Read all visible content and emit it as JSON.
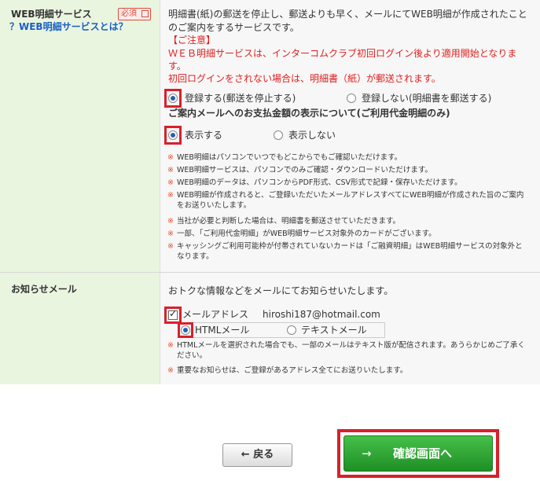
{
  "web_statement": {
    "label": "WEB明細サービス",
    "required_badge": "必須",
    "help_link": "？WEB明細サービスとは？",
    "intro_line1": "明細書(紙)の郵送を停止し、郵送よりも早く、メールにてWEB明細が作成されたこと",
    "intro_line2": "のご案内をするサービスです。",
    "caution_title": "【ご注意】",
    "caution_line1": "ＷＥＢ明細サービスは、インターコムクラブ初回ログイン後より適用開始となりま",
    "caution_line2": "す。",
    "caution_line3": "初回ログインをされない場合は、明細書（紙）が郵送されます。",
    "register_option": "登録する(郵送を停止する)",
    "no_register_option": "登録しない(明細書を郵送する)",
    "register_selected": true,
    "amount_heading": "ご案内メールへのお支払金額の表示について(ご利用代金明細のみ)",
    "show_option": "表示する",
    "hide_option": "表示しない",
    "show_selected": true,
    "notes": [
      "WEB明細はパソコンでいつでもどこからでもご確認いただけます。",
      "WEB明細サービスは、パソコンでのみご確認・ダウンロードいただけます。",
      "WEB明細のデータは、パソコンからPDF形式、CSV形式で記録・保存いただけます。",
      "WEB明細が作成されると、ご登録いただいたメールアドレスすべてにWEB明細が作成された旨のご案内をお送りいたします。",
      "当社が必要と判断した場合は、明細書を郵送させていただきます。",
      "一部、「ご利用代金明細」がWEB明細サービス対象外のカードがございます。",
      "キャッシングご利用可能枠が付帯されていないカードは「ご融資明細」はWEB明細サービスの対象外となります。"
    ],
    "note_mark": "※"
  },
  "notice_mail": {
    "label": "お知らせメール",
    "intro": "おトクな情報などをメールにてお知らせいたします。",
    "email_checkbox_label": "メールアドレス",
    "email_checked": true,
    "email_address": "hiroshi187@hotmail.com",
    "html_option": "HTMLメール",
    "text_option": "テキストメール",
    "html_selected": true,
    "notes": [
      "HTMLメールを選択された場合でも、一部のメールはテキスト版が配信されます。あうらかじめご了承ください。",
      "重要なお知らせは、ご登録があるアドレス全てにお送りいたします。"
    ],
    "note_mark": "※"
  },
  "buttons": {
    "back_label": "← 戻る",
    "confirm_arrow": "→",
    "confirm_label": "確認画面へ"
  },
  "colors": {
    "highlight_red": "#d8202a",
    "confirm_green": "#2ea832",
    "label_bg": "#eaf5e0",
    "link_blue": "#1a5fc4"
  }
}
